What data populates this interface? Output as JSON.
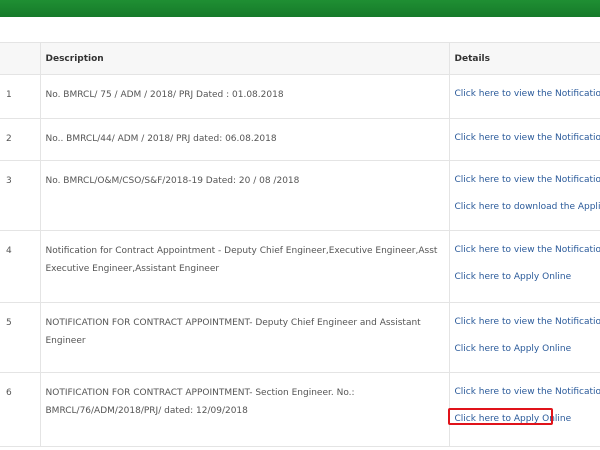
{
  "table": {
    "headers": {
      "sl": "",
      "description": "Description",
      "details": "Details"
    },
    "rows": [
      {
        "sl": "1",
        "description": "No. BMRCL/ 75 / ADM / 2018/ PRJ Dated : 01.08.2018",
        "links": [
          "Click here to view the Notification"
        ]
      },
      {
        "sl": "2",
        "description": "No.. BMRCL/44/ ADM / 2018/ PRJ dated: 06.08.2018",
        "links": [
          "Click here to view the Notification"
        ]
      },
      {
        "sl": "3",
        "description": "No. BMRCL/O&M/CSO/S&F/2018-19 Dated: 20 / 08 /2018",
        "links": [
          "Click here to view the Notification",
          "Click here to download the Application form"
        ]
      },
      {
        "sl": "4",
        "description": "Notification for Contract Appointment - Deputy Chief Engineer,Executive Engineer,Asst Executive Engineer,Assistant Engineer",
        "links": [
          "Click here to view the Notification",
          "Click here to Apply Online"
        ]
      },
      {
        "sl": "5",
        "description": "NOTIFICATION FOR CONTRACT APPOINTMENT- Deputy Chief Engineer and Assistant Engineer",
        "links": [
          "Click here to view the Notification",
          "Click here to Apply Online"
        ]
      },
      {
        "sl": "6",
        "description": "NOTIFICATION FOR CONTRACT APPOINTMENT- Section Engineer. No.: BMRCL/76/ADM/2018/PRJ/ dated: 12/09/2018",
        "links": [
          "Click here to view the Notification",
          "Click here to Apply Online"
        ]
      }
    ]
  },
  "colors": {
    "header_bar": "#1f8f33",
    "link": "#2a5a9a",
    "highlight": "#e0131a"
  }
}
